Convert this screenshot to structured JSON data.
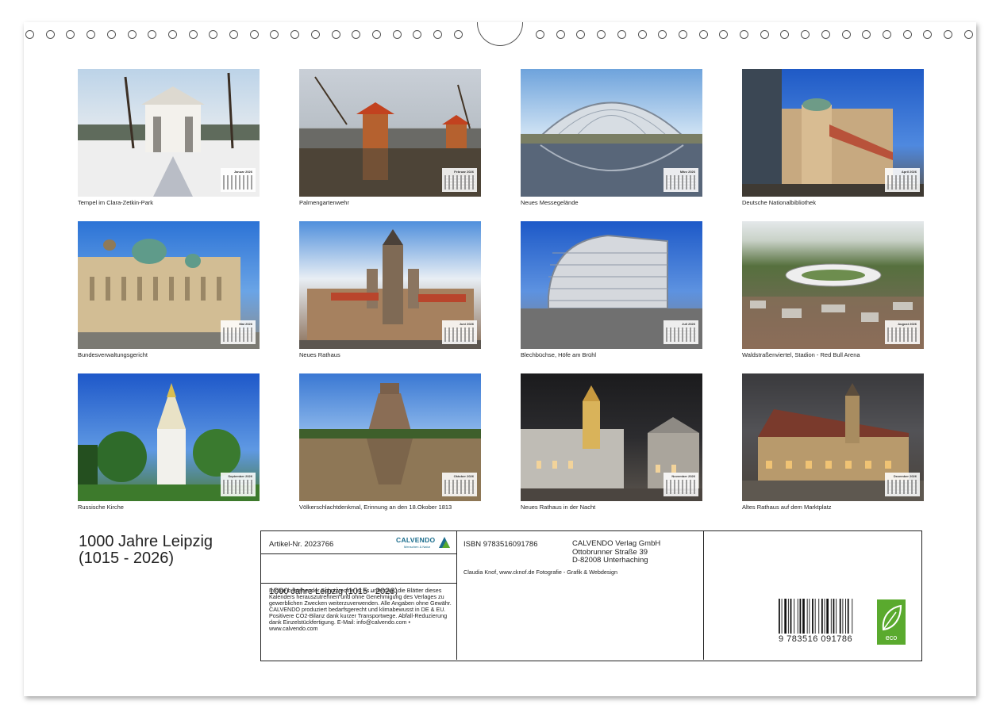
{
  "photos": [
    {
      "caption": "Tempel im Clara-Zetkin-Park",
      "month": "Januar 2026"
    },
    {
      "caption": "Palmengartenwehr",
      "month": "Februar 2026"
    },
    {
      "caption": "Neues Messegelände",
      "month": "März 2026"
    },
    {
      "caption": "Deutsche Nationalbibliothek",
      "month": "April 2026"
    },
    {
      "caption": "Bundesverwaltungsgericht",
      "month": "Mai 2026"
    },
    {
      "caption": "Neues Rathaus",
      "month": "Juni 2026"
    },
    {
      "caption": "Blechbüchse, Höfe am Brühl",
      "month": "Juli 2026"
    },
    {
      "caption": "Waldstraßenviertel, Stadion - Red Bull Arena",
      "month": "August 2026"
    },
    {
      "caption": "Russische Kirche",
      "month": "September 2026"
    },
    {
      "caption": "Völkerschlachtdenkmal, Erinnung an den 18.Okober 1813",
      "month": "Oktober 2026"
    },
    {
      "caption": "Neues Rathaus in der Nacht",
      "month": "November 2026"
    },
    {
      "caption": "Altes Rathaus auf dem Marktplatz",
      "month": "Dezember 2026"
    }
  ],
  "title": "1000 Jahre Leipzig\n(1015 - 2026)",
  "info": {
    "artikel": "Artikel-Nr. 2023766",
    "logo_word": "CALVENDO",
    "logo_tag": "Menschen & Natur",
    "calendar_title": "1000 Jahre Leipzig (1015 - 2026)",
    "legal": "Infolge bestehender Schutzrechte ist es untersagt, die Blätter dieses Kalenders herauszutrennen und ohne Genehmigung des Verlages zu gewerblichen Zwecken weiterzuverwenden. Alle Angaben ohne Gewähr. CALVENDO produziert bedarfsgerecht und klimabewusst in DE & EU. Positivere CO2-Bilanz dank kurzer Transportwege. Abfall-Reduzierung dank Einzelstückfertigung. E-Mail: info@calvendo.com • www.calvendo.com",
    "isbn": "ISBN 9783516091786",
    "publisher": "CALVENDO Verlag GmbH\nOttobrunner Straße 39\nD-82008 Unterhaching",
    "credits": "Claudia Knof, www.cknof.de Fotografie - Grafik & Webdesign",
    "barcode_number": "9 783516 091786",
    "eco_label": "eco"
  },
  "colors": {
    "sky": "#3f7fd6",
    "eco_green": "#5aaa2e",
    "calvendo_blue": "#1a6c8c"
  }
}
